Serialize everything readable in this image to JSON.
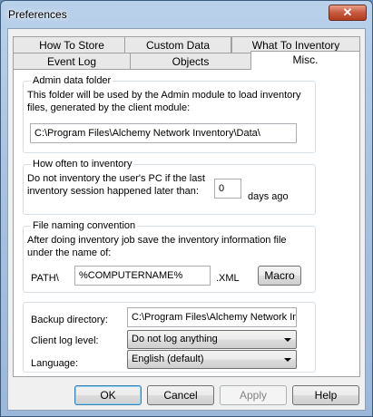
{
  "window": {
    "title": "Preferences",
    "close_symbol": "✕"
  },
  "tabs": {
    "row_back": [
      "How To Store",
      "Custom Data",
      "What To Inventory"
    ],
    "row_front": [
      "Event Log",
      "Objects",
      "Misc."
    ],
    "active": "Misc."
  },
  "admin_folder": {
    "title": "Admin data folder",
    "description": "This folder will be used by the Admin module to load inventory files, generated by the client module:",
    "path": "C:\\Program Files\\Alchemy Network Inventory\\Data\\"
  },
  "frequency": {
    "title": "How often to inventory",
    "description": "Do not inventory the user's PC if the last inventory session happened later than:",
    "days_value": "0",
    "days_suffix": "days ago"
  },
  "naming": {
    "title": "File naming convention",
    "description": "After doing inventory job save the inventory information file under the name of:",
    "prefix": "PATH\\",
    "name_value": "%COMPUTERNAME%",
    "extension": ".XML",
    "macro_label": "Macro"
  },
  "misc_settings": {
    "backup_label": "Backup directory:",
    "backup_value": "C:\\Program Files\\Alchemy Network Inv",
    "client_log_label": "Client log level:",
    "client_log_value": "Do not log anything",
    "language_label": "Language:",
    "language_value": "English (default)"
  },
  "buttons": {
    "ok": "OK",
    "cancel": "Cancel",
    "apply": "Apply",
    "help": "Help"
  }
}
